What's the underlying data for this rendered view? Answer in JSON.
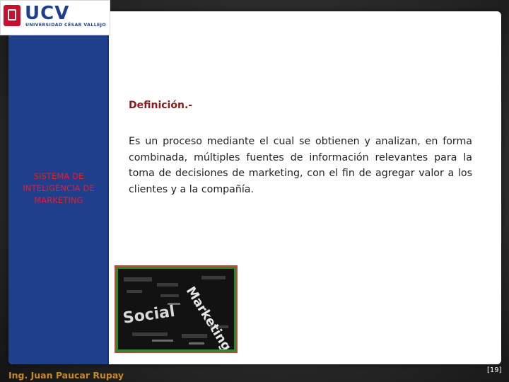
{
  "logo": {
    "main": "UCV",
    "sub": "UNIVERSIDAD CÉSAR VALLEJO"
  },
  "sidebar": {
    "label": "SISTEMA DE INTELIGENCIA DE MARKETING"
  },
  "content": {
    "heading": "Definición.-",
    "paragraph": "Es un proceso mediante el cual se obtienen y analizan, en forma combinada, múltiples fuentes de información relevantes para la toma de decisiones de marketing, con el fin de agregar valor a los clientes y a la compañía."
  },
  "image": {
    "words": [
      "Social",
      "Marketing"
    ]
  },
  "footer": {
    "author": "Ing. Juan Paucar Rupay",
    "page": "[19]"
  },
  "colors": {
    "sidebar": "#1f3f8c",
    "heading": "#8b1a1a",
    "sidebar_label": "#e0202a",
    "footer_author": "#c48a28"
  }
}
